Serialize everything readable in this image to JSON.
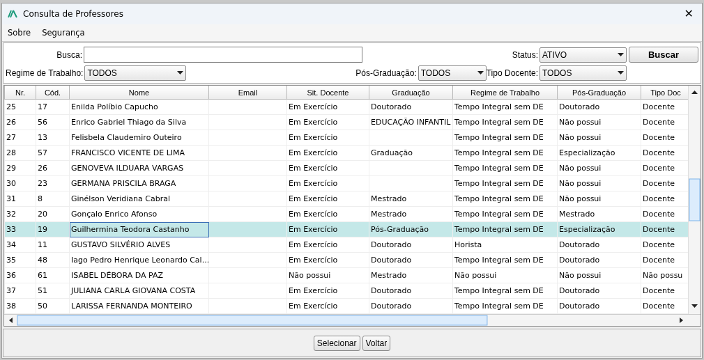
{
  "window": {
    "title": "Consulta de Professores",
    "close": "✕"
  },
  "menu": [
    "Sobre",
    "Segurança"
  ],
  "filters": {
    "search": {
      "label": "Busca:"
    },
    "status": {
      "label": "Status:",
      "value": "ATIVO"
    },
    "search_button": "Buscar",
    "regime": {
      "label": "Regime de Trabalho:",
      "value": "TODOS"
    },
    "pos": {
      "label": "Pós-Graduação:",
      "value": "TODOS"
    },
    "tipo": {
      "label": "Tipo Docente:",
      "value": "TODOS"
    }
  },
  "table": {
    "columns": [
      "Nr.",
      "Cód.",
      "Nome",
      "Email",
      "Sit. Docente",
      "Graduação",
      "Regime de Trabalho",
      "Pós-Graduação",
      "Tipo Doc"
    ],
    "rows": [
      {
        "cells": [
          "25",
          "17",
          "Enilda Políbio Capucho",
          "",
          "Em Exercício",
          "Doutorado",
          "Tempo Integral sem DE",
          "Doutorado",
          "Docente"
        ],
        "selected": false
      },
      {
        "cells": [
          "26",
          "56",
          "Enrico Gabriel Thiago da Silva",
          "",
          "Em Exercício",
          "EDUCAÇÃO INFANTIL",
          "Tempo Integral sem DE",
          "Não possui",
          "Docente"
        ],
        "selected": false
      },
      {
        "cells": [
          "27",
          "13",
          "Felisbela Claudemiro Outeiro",
          "",
          "Em Exercício",
          "",
          "Tempo Integral sem DE",
          "Não possui",
          "Docente"
        ],
        "selected": false
      },
      {
        "cells": [
          "28",
          "57",
          "FRANCISCO VICENTE DE LIMA",
          "",
          "Em Exercício",
          "Graduação",
          "Tempo Integral sem DE",
          "Especialização",
          "Docente"
        ],
        "selected": false
      },
      {
        "cells": [
          "29",
          "26",
          "GENOVEVA ILDUARA VARGAS",
          "",
          "Em Exercício",
          "",
          "Tempo Integral sem DE",
          "Não possui",
          "Docente"
        ],
        "selected": false
      },
      {
        "cells": [
          "30",
          "23",
          "GERMANA PRISCILA BRAGA",
          "",
          "Em Exercício",
          "",
          "Tempo Integral sem DE",
          "Não possui",
          "Docente"
        ],
        "selected": false
      },
      {
        "cells": [
          "31",
          "8",
          "Ginélson Veridiana Cabral",
          "",
          "Em Exercício",
          "Mestrado",
          "Tempo Integral sem DE",
          "Não possui",
          "Docente"
        ],
        "selected": false
      },
      {
        "cells": [
          "32",
          "20",
          "Gonçalo Enrico Afonso",
          "",
          "Em Exercício",
          "Mestrado",
          "Tempo Integral sem DE",
          "Mestrado",
          "Docente"
        ],
        "selected": false
      },
      {
        "cells": [
          "33",
          "19",
          "Guilhermina Teodora Castanho",
          "",
          "Em Exercício",
          "Pós-Graduação",
          "Tempo Integral sem DE",
          "Especialização",
          "Docente"
        ],
        "selected": true
      },
      {
        "cells": [
          "34",
          "11",
          "GUSTAVO SILVÉRIO ALVES",
          "",
          "Em Exercício",
          "Doutorado",
          "Horista",
          "Doutorado",
          "Docente"
        ],
        "selected": false
      },
      {
        "cells": [
          "35",
          "48",
          "Iago Pedro Henrique Leonardo Cal...",
          "",
          "Em Exercício",
          "Doutorado",
          "Tempo Integral sem DE",
          "Doutorado",
          "Docente"
        ],
        "selected": false
      },
      {
        "cells": [
          "36",
          "61",
          "ISABEL DÉBORA DA PAZ",
          "",
          "Não possui",
          "Mestrado",
          "Não possui",
          "Não possui",
          "Não possu"
        ],
        "selected": false
      },
      {
        "cells": [
          "37",
          "51",
          "JULIANA CARLA GIOVANA COSTA",
          "",
          "Em Exercício",
          "Doutorado",
          "Tempo Integral sem DE",
          "Doutorado",
          "Docente"
        ],
        "selected": false
      },
      {
        "cells": [
          "38",
          "50",
          "LARISSA FERNANDA MONTEIRO",
          "",
          "Em Exercício",
          "Doutorado",
          "Tempo Integral sem DE",
          "Doutorado",
          "Docente"
        ],
        "selected": false
      }
    ]
  },
  "buttons": [
    "Selecionar",
    "Voltar"
  ]
}
